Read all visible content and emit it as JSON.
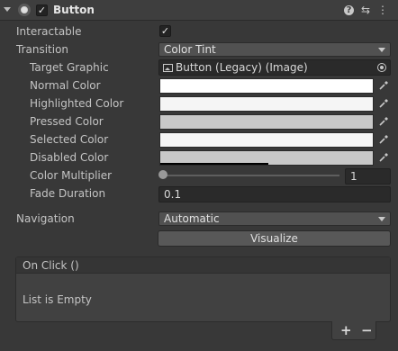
{
  "component": {
    "title": "Button",
    "enabled": true,
    "icons": [
      "foldout-arrow-icon",
      "component-icon",
      "help-icon",
      "preset-icon",
      "overflow-menu-icon"
    ]
  },
  "interactable": {
    "label": "Interactable",
    "checked": true
  },
  "transition": {
    "label": "Transition",
    "value": "Color Tint"
  },
  "target_graphic": {
    "label": "Target Graphic",
    "value": "Button (Legacy) (Image)"
  },
  "colors": {
    "normal": {
      "label": "Normal Color",
      "hex": "#FFFFFF",
      "alpha": 1.0
    },
    "highlighted": {
      "label": "Highlighted Color",
      "hex": "#F5F5F5",
      "alpha": 1.0
    },
    "pressed": {
      "label": "Pressed Color",
      "hex": "#C8C8C8",
      "alpha": 1.0
    },
    "selected": {
      "label": "Selected Color",
      "hex": "#F5F5F5",
      "alpha": 1.0
    },
    "disabled": {
      "label": "Disabled Color",
      "hex": "#C8C8C8",
      "alpha": 0.5
    }
  },
  "color_multiplier": {
    "label": "Color Multiplier",
    "value": "1",
    "slider_fraction": 0.0
  },
  "fade_duration": {
    "label": "Fade Duration",
    "value": "0.1"
  },
  "navigation": {
    "label": "Navigation",
    "value": "Automatic"
  },
  "visualize_button": "Visualize",
  "on_click": {
    "title": "On Click ()",
    "empty_text": "List is Empty",
    "add": "+",
    "remove": "−"
  }
}
